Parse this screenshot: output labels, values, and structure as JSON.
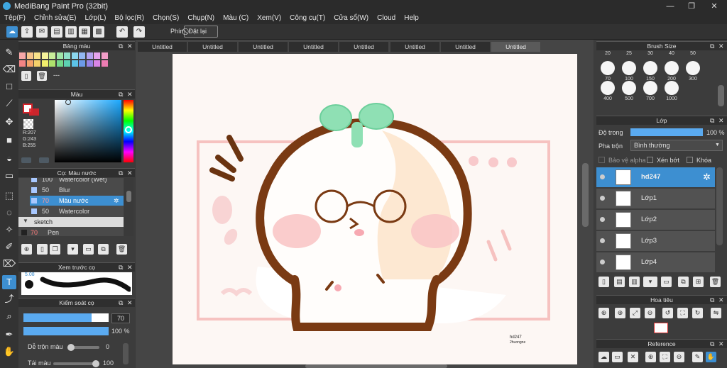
{
  "app": {
    "title": "MediBang Paint Pro (32bit)",
    "minimize": "—",
    "maximize": "❐",
    "close": "✕"
  },
  "menu": [
    "Tệp(F)",
    "Chỉnh sửa(E)",
    "Lớp(L)",
    "Bộ lọc(R)",
    "Chọn(S)",
    "Chụp(N)",
    "Màu (C)",
    "Xem(V)",
    "Công cụ(T)",
    "Cửa sổ(W)",
    "Cloud",
    "Help"
  ],
  "toolbar": {
    "shortcut_label": "Phím",
    "reset_label": "Đặt lại"
  },
  "tabs": [
    "Untitled",
    "Untitled",
    "Untitled",
    "Untitled",
    "Untitled",
    "Untitled",
    "Untitled",
    "Untitled"
  ],
  "palette": {
    "title": "Bảng màu",
    "colors": [
      "#f8a8a8",
      "#f7c48a",
      "#f9e28a",
      "#f6f39a",
      "#c8ee9a",
      "#a0e6a8",
      "#8ee0c8",
      "#8ad6ee",
      "#93b8f2",
      "#b4a4f0",
      "#e6a4ee",
      "#f29ec8",
      "#f28484",
      "#f4a26a",
      "#f4d06a",
      "#f2ee6c",
      "#aee26c",
      "#72d88a",
      "#5cd2b2",
      "#5cc4e8",
      "#6c9ae8",
      "#9682e6",
      "#d884e6",
      "#ec7cb2"
    ],
    "current_name": "---"
  },
  "color": {
    "title": "Màu",
    "r": "R:207",
    "g": "G:243",
    "b": "B:255",
    "hex": "#CFF3FF",
    "primary": "#d8222a",
    "secondary": "#ffffff"
  },
  "brush_list": {
    "title": "Cọ: Màu nước",
    "items": [
      {
        "size": "100",
        "name": "Watercolor (Wet)",
        "color": "#a8c8ff",
        "selected": false
      },
      {
        "size": "50",
        "name": "Blur",
        "color": "#a8c8ff",
        "selected": false
      },
      {
        "size": "70",
        "name": "Màu nước",
        "color": "#a8c8ff",
        "selected": true
      },
      {
        "size": "50",
        "name": "Watercolor",
        "color": "#a8c8ff",
        "selected": false
      }
    ],
    "group": "sketch",
    "pen": {
      "size": "70",
      "name": "Pen"
    }
  },
  "brush_preview": {
    "title": "Xem trước cọ",
    "size": "5.08"
  },
  "brush_control": {
    "title": "Kiểm soát cọ",
    "size_value": "70",
    "opacity_value": "100 %",
    "blend_label": "Dễ trộn màu",
    "blend_value": "0",
    "reload_label": "Tái màu",
    "reload_value": "100",
    "size_fraction": 0.8,
    "opacity_fraction": 1.0
  },
  "brush_size": {
    "title": "Brush Size",
    "sizes": [
      "20",
      "25",
      "30",
      "40",
      "50",
      "70",
      "100",
      "150",
      "200",
      "300",
      "400",
      "500",
      "700",
      "1000"
    ]
  },
  "layer_panel": {
    "title": "Lớp",
    "opacity_label": "Độ trong",
    "opacity_value": "100 %",
    "opacity_fraction": 1.0,
    "blend_label": "Pha trộn",
    "blend_value": "Bình thường",
    "protect_alpha": "Bảo vệ alpha",
    "clipping": "Xén bớt",
    "lock": "Khóa"
  },
  "layers": [
    {
      "name": "hd247",
      "selected": true
    },
    {
      "name": "Lớp1",
      "selected": false
    },
    {
      "name": "Lớp2",
      "selected": false
    },
    {
      "name": "Lớp3",
      "selected": false
    },
    {
      "name": "Lớp4",
      "selected": false
    }
  ],
  "navigator": {
    "title": "Hoa tiêu"
  },
  "reference": {
    "title": "Reference"
  },
  "canvas": {
    "watermark_line1": "hd247",
    "watermark_line2": "2huongne",
    "background": "#fdf7f4"
  }
}
